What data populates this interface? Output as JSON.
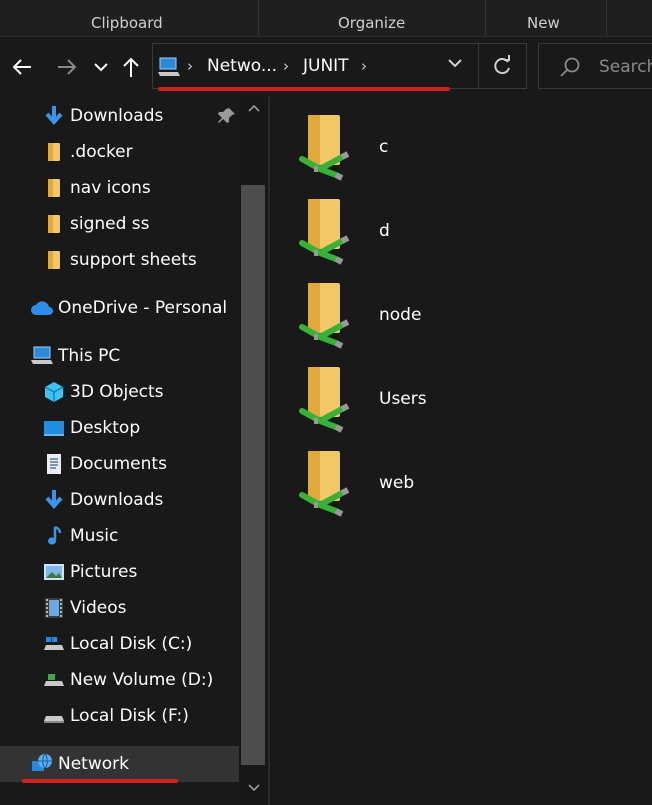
{
  "ribbon": {
    "groups": [
      "Clipboard",
      "Organize",
      "New"
    ]
  },
  "address": {
    "crumbs": [
      "Netwo...",
      "JUNIT"
    ],
    "icon": "pc-icon"
  },
  "search": {
    "placeholder": "Search"
  },
  "nav": {
    "items": [
      {
        "label": "Downloads",
        "icon": "download-arrow-icon",
        "pinned": true
      },
      {
        "label": ".docker",
        "icon": "folder-icon"
      },
      {
        "label": "nav icons",
        "icon": "folder-icon"
      },
      {
        "label": "signed ss",
        "icon": "folder-icon"
      },
      {
        "label": "support sheets",
        "icon": "folder-icon"
      },
      {
        "label": "OneDrive - Personal",
        "icon": "cloud-icon"
      },
      {
        "label": "This PC",
        "icon": "pc-icon"
      },
      {
        "label": "3D Objects",
        "icon": "cube-icon"
      },
      {
        "label": "Desktop",
        "icon": "desktop-icon"
      },
      {
        "label": "Documents",
        "icon": "document-icon"
      },
      {
        "label": "Downloads",
        "icon": "download-arrow-icon"
      },
      {
        "label": "Music",
        "icon": "music-note-icon"
      },
      {
        "label": "Pictures",
        "icon": "picture-icon"
      },
      {
        "label": "Videos",
        "icon": "film-icon"
      },
      {
        "label": "Local Disk (C:)",
        "icon": "drive-icon"
      },
      {
        "label": "New Volume (D:)",
        "icon": "drive-icon"
      },
      {
        "label": "Local Disk (F:)",
        "icon": "drive-icon"
      },
      {
        "label": "Network",
        "icon": "network-globe-icon",
        "selected": true
      }
    ]
  },
  "content": {
    "folders": [
      {
        "name": "c",
        "icon": "network-share-folder-icon"
      },
      {
        "name": "d",
        "icon": "network-share-folder-icon"
      },
      {
        "name": "node",
        "icon": "network-share-folder-icon"
      },
      {
        "name": "Users",
        "icon": "network-share-folder-icon"
      },
      {
        "name": "web",
        "icon": "network-share-folder-icon"
      }
    ]
  },
  "colors": {
    "accent_underline": "#d61f1f",
    "background": "#191919",
    "folder": "#f3c766",
    "share_pipe": "#36b336"
  }
}
